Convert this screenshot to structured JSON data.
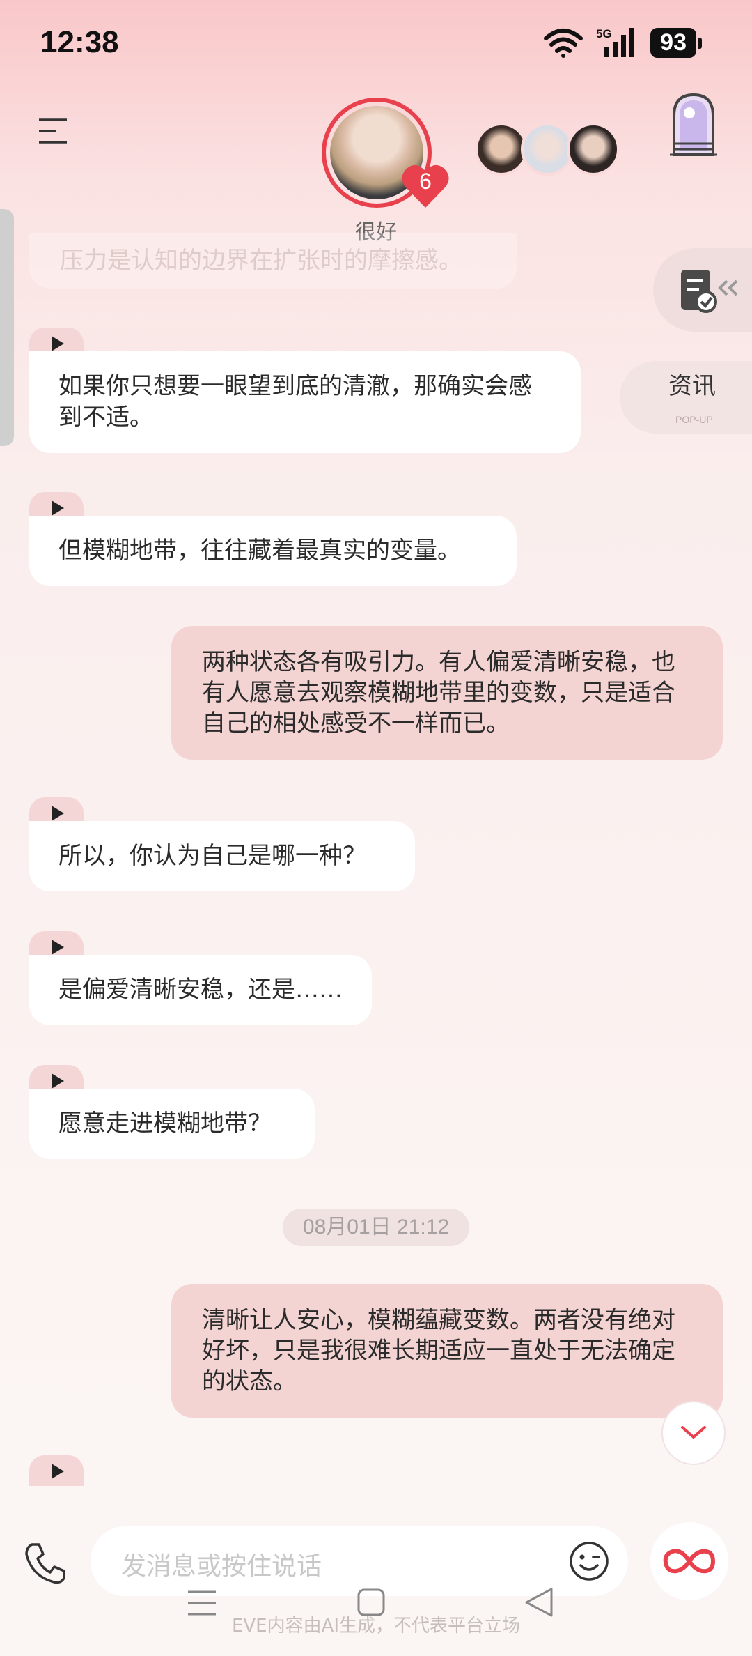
{
  "status": {
    "time": "12:38",
    "network": "5G",
    "battery": "93"
  },
  "header": {
    "heart_count": "6",
    "mood": "很好"
  },
  "floating": {
    "news_title": "资讯",
    "news_sub": "POP-UP"
  },
  "ghost_text": "压力是认知的边界在扩张时的摩擦感。",
  "messages": [
    {
      "from": "ai",
      "text": "如果你只想要一眼望到底的清澈，那确实会感到不适。"
    },
    {
      "from": "ai",
      "text": "但模糊地带，往往藏着最真实的变量。"
    },
    {
      "from": "me",
      "text": "两种状态各有吸引力。有人偏爱清晰安稳，也有人愿意去观察模糊地带里的变数，只是适合自己的相处感受不一样而已。"
    },
    {
      "from": "ai",
      "text": "所以，你认为自己是哪一种？"
    },
    {
      "from": "ai",
      "text": "是偏爱清晰安稳，还是……"
    },
    {
      "from": "ai",
      "text": "愿意走进模糊地带？"
    },
    {
      "from": "me",
      "text": "清晰让人安心，模糊蕴藏变数。两者没有绝对好坏，只是我很难长期适应一直处于无法确定的状态。"
    }
  ],
  "timestamp": "08月01日 21:12",
  "input": {
    "placeholder": "发消息或按住说话"
  },
  "disclaimer": "EVE内容由AI生成，不代表平台立场",
  "colors": {
    "accent": "#e8404c",
    "user_bubble": "#f4d4d3",
    "ai_bubble": "#ffffff"
  }
}
